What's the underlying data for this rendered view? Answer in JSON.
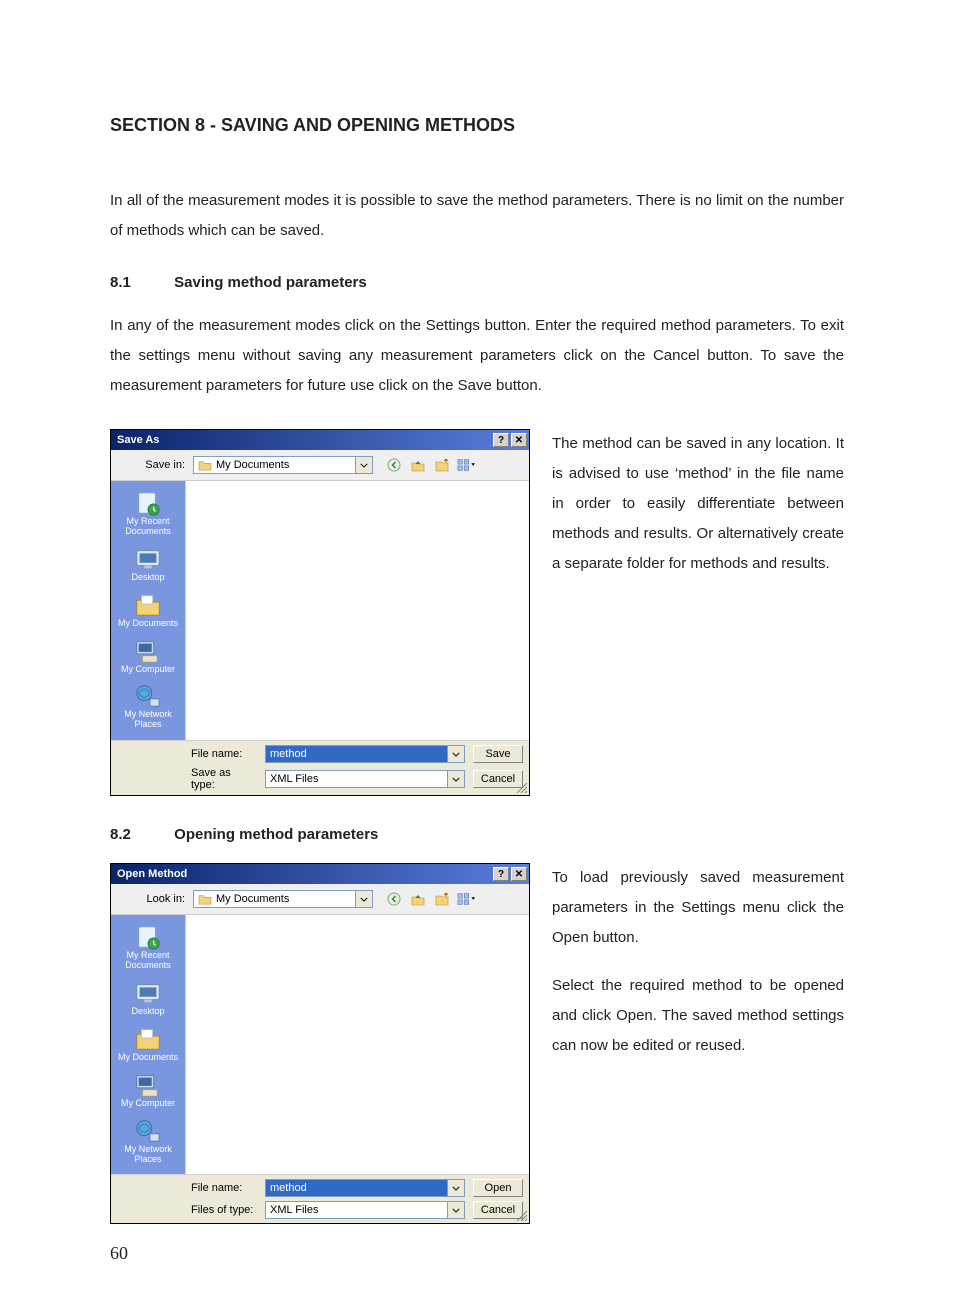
{
  "page_number": "60",
  "section_title": "SECTION 8 - SAVING AND OPENING METHODS",
  "intro_para": "In all of the measurement modes it is possible to save the method parameters. There is no limit on the number of methods which can be saved.",
  "sub1": {
    "num": "8.1",
    "title": "Saving method parameters"
  },
  "para_8_1": "In any of the measurement modes click on the Settings button. Enter the required method parameters. To exit the settings menu without saving any measurement parameters click on the Cancel button. To save the measurement parameters for future use click on the Save button.",
  "side_8_1": "The method can be saved in any location. It is advised to use ‘method’ in the file name in order to easily differentiate between methods and results. Or alternatively create a separate folder for methods and results.",
  "sub2": {
    "num": "8.2",
    "title": "Opening method parameters"
  },
  "side_8_2_a": "To load previously saved measurement parameters in the Settings menu click the Open button.",
  "side_8_2_b": "Select the required method to be opened and click Open. The saved method settings can now be edited or reused.",
  "save_dialog": {
    "title": "Save As",
    "savein_label": "Save in:",
    "location": "My Documents",
    "places": [
      "My Recent Documents",
      "Desktop",
      "My Documents",
      "My Computer",
      "My Network Places"
    ],
    "filename_label": "File name:",
    "filename_value": "method",
    "filetype_label": "Save as type:",
    "filetype_value": "XML Files",
    "primary_btn": "Save",
    "cancel_btn": "Cancel"
  },
  "open_dialog": {
    "title": "Open Method",
    "lookin_label": "Look in:",
    "location": "My Documents",
    "places": [
      "My Recent Documents",
      "Desktop",
      "My Documents",
      "My Computer",
      "My Network Places"
    ],
    "filename_label": "File name:",
    "filename_value": "method",
    "filetype_label": "Files of type:",
    "filetype_value": "XML Files",
    "primary_btn": "Open",
    "cancel_btn": "Cancel"
  }
}
